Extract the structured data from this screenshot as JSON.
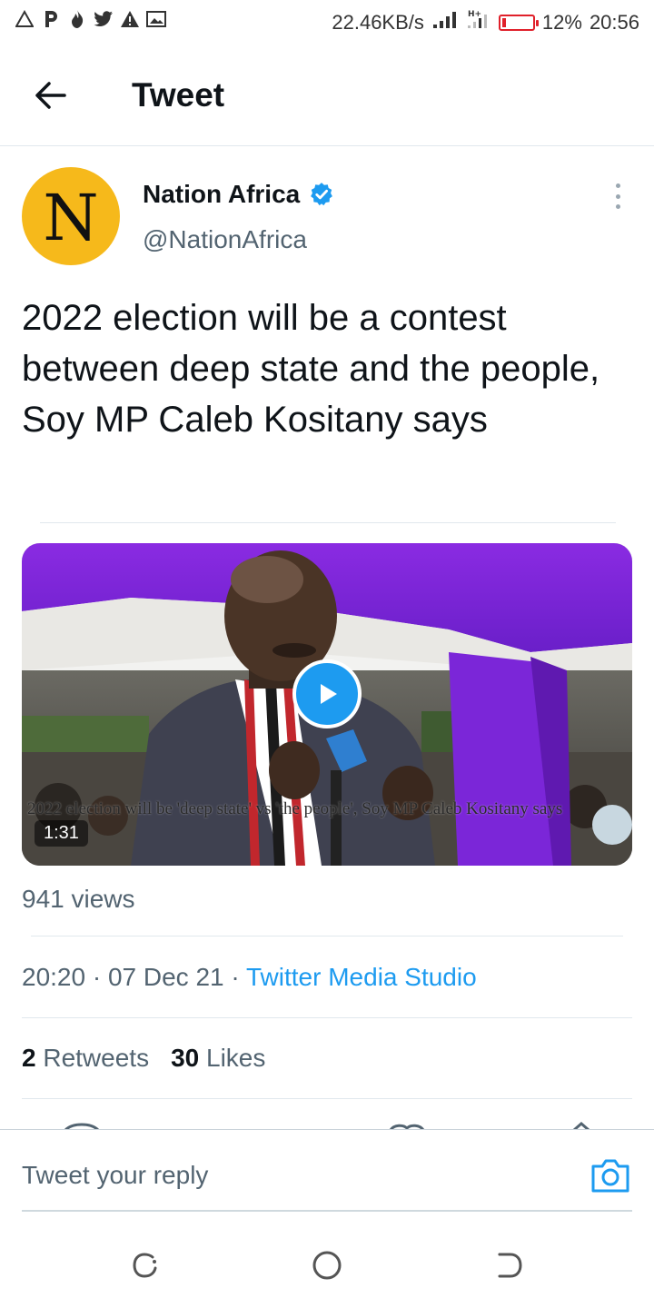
{
  "status_bar": {
    "speed": "22.46KB/s",
    "battery_percent": "12%",
    "battery_level": 0.12,
    "time": "20:56",
    "battery_color": "#e0202a"
  },
  "header": {
    "title": "Tweet",
    "back_icon": "arrow-left-icon"
  },
  "tweet": {
    "avatar_letter": "N",
    "avatar_color": "#f6b91b",
    "author_name": "Nation Africa",
    "handle": "@NationAfrica",
    "verified": true,
    "text": "2022 election will be a contest between deep state and the people, Soy MP Caleb Kositany says",
    "video": {
      "caption": "2022 election will be 'deep state' vs 'the people', Soy MP Caleb Kositany says",
      "duration": "1:31"
    },
    "views": "941 views",
    "time": "20:20",
    "date": "07 Dec 21",
    "source": "Twitter Media Studio",
    "retweets_count": "2",
    "retweets_label": "Retweets",
    "likes_count": "30",
    "likes_label": "Likes"
  },
  "reply": {
    "placeholder": "Tweet your reply"
  },
  "accent_color": "#1d9bf0"
}
